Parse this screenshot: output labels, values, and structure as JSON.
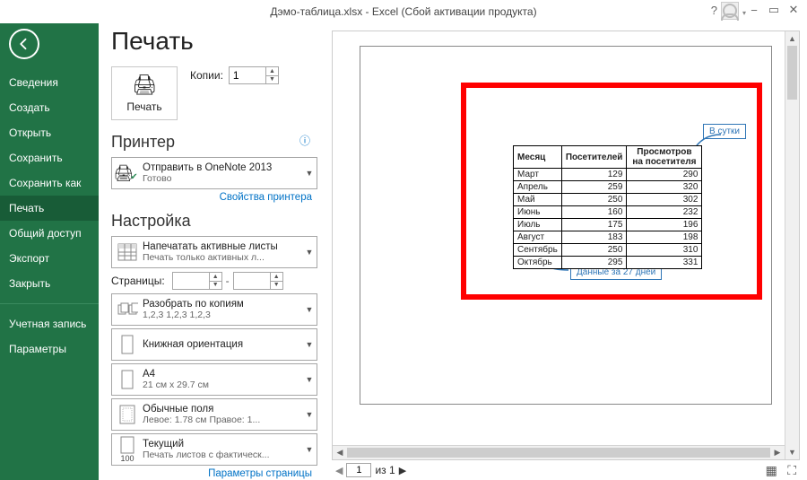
{
  "titlebar": {
    "title": "Дэмо-таблица.xlsx - Excel (Сбой активации продукта)"
  },
  "sidebar": {
    "items": [
      {
        "label": "Сведения"
      },
      {
        "label": "Создать"
      },
      {
        "label": "Открыть"
      },
      {
        "label": "Сохранить"
      },
      {
        "label": "Сохранить как"
      },
      {
        "label": "Печать"
      },
      {
        "label": "Общий доступ"
      },
      {
        "label": "Экспорт"
      },
      {
        "label": "Закрыть"
      }
    ],
    "items2": [
      {
        "label": "Учетная запись"
      },
      {
        "label": "Параметры"
      }
    ]
  },
  "page": {
    "title": "Печать"
  },
  "print": {
    "button_label": "Печать",
    "copies_label": "Копии:",
    "copies_value": "1"
  },
  "printer": {
    "section": "Принтер",
    "name": "Отправить в OneNote 2013",
    "status": "Готово",
    "props_link": "Свойства принтера"
  },
  "settings": {
    "section": "Настройка",
    "sheets": {
      "l1": "Напечатать активные листы",
      "l2": "Печать только активных л..."
    },
    "pages_label": "Страницы:",
    "collate": {
      "l1": "Разобрать по копиям",
      "l2": "1,2,3   1,2,3   1,2,3"
    },
    "orient": {
      "l1": "Книжная ориентация",
      "l2": ""
    },
    "paper": {
      "l1": "A4",
      "l2": "21 см x 29.7 см"
    },
    "margins": {
      "l1": "Обычные поля",
      "l2": "Левое: 1.78 см  Правое: 1..."
    },
    "scaling": {
      "l1": "Текущий",
      "l2": "Печать листов с фактическ..."
    },
    "params_link": "Параметры страницы"
  },
  "preview": {
    "annotation_right": "В сутки",
    "annotation_bottom": "Данные за 27 дней",
    "page_current": "1",
    "page_of": "из 1",
    "table": {
      "headers": [
        "Месяц",
        "Посетителей",
        "Просмотров на посетителя"
      ],
      "rows": [
        [
          "Март",
          "129",
          "290"
        ],
        [
          "Апрель",
          "259",
          "320"
        ],
        [
          "Май",
          "250",
          "302"
        ],
        [
          "Июнь",
          "160",
          "232"
        ],
        [
          "Июль",
          "175",
          "196"
        ],
        [
          "Август",
          "183",
          "198"
        ],
        [
          "Сентябрь",
          "250",
          "310"
        ],
        [
          "Октябрь",
          "295",
          "331"
        ]
      ]
    }
  }
}
